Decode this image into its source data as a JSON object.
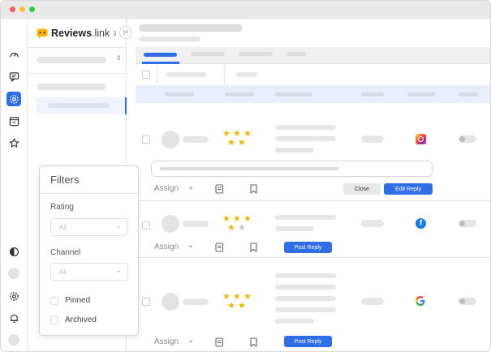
{
  "app": {
    "brand": "Reviews",
    "brand_suffix": ".link",
    "accent": "#2f6ee6"
  },
  "titlebar": {
    "dots": [
      "#f25f58",
      "#fbbe3f",
      "#34c84a"
    ]
  },
  "filters": {
    "title": "Filters",
    "rating": {
      "label": "Rating",
      "value": "All"
    },
    "channel": {
      "label": "Channel",
      "value": "All"
    },
    "pinned": {
      "label": "Pinned",
      "checked": false
    },
    "archived": {
      "label": "Archived",
      "checked": false
    }
  },
  "reviews": [
    {
      "stars": 5,
      "channel": "instagram-icon",
      "assign_label": "Assign",
      "close_label": "Close",
      "edit_label": "Edit Reply"
    },
    {
      "stars": 4,
      "channel": "facebook-icon",
      "assign_label": "Assign",
      "reply_label": "Post Reply"
    },
    {
      "stars": 5,
      "channel": "google-icon",
      "assign_label": "Assign",
      "reply_label": "Post Reply"
    }
  ]
}
